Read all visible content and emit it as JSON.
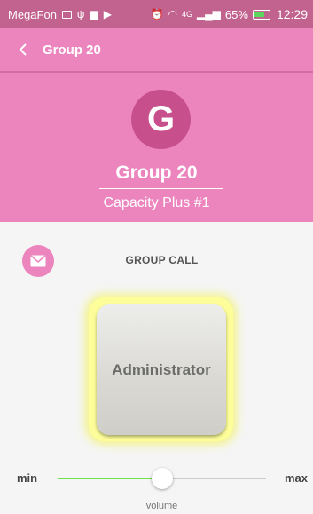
{
  "status_bar": {
    "carrier": "MegaFon",
    "network": "4G",
    "battery": "65%",
    "time": "12:29"
  },
  "app_bar": {
    "title": "Group 20",
    "back_icon": "chevron-left-icon"
  },
  "header": {
    "avatar_letter": "G",
    "group_name": "Group 20",
    "subtitle": "Capacity Plus #1"
  },
  "call": {
    "label": "GROUP CALL",
    "mail_icon": "envelope-icon",
    "ptt_label": "Administrator"
  },
  "volume": {
    "min_label": "min",
    "max_label": "max",
    "label": "volume",
    "level": 0.5
  },
  "colors": {
    "status_bar": "#c2628f",
    "accent": "#ec84be",
    "avatar": "#c74f8c",
    "slider_fill": "#6ee24b",
    "ptt_glow": "#fdfd9a"
  }
}
